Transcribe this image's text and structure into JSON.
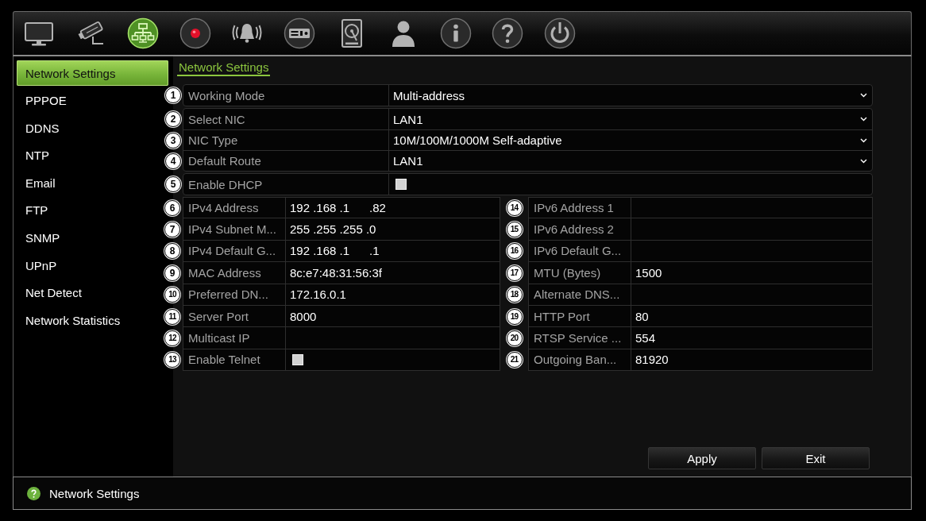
{
  "toolbar": [
    {
      "selected": false
    },
    {
      "selected": false
    },
    {
      "selected": true
    },
    {
      "selected": false
    },
    {
      "selected": false
    },
    {
      "selected": false
    },
    {
      "selected": false
    },
    {
      "selected": false
    },
    {
      "selected": false
    },
    {
      "selected": false
    },
    {
      "selected": false
    }
  ],
  "sidebar": {
    "items": [
      {
        "label": "Network Settings",
        "selected": true
      },
      {
        "label": "PPPOE",
        "selected": false
      },
      {
        "label": "DDNS",
        "selected": false
      },
      {
        "label": "NTP",
        "selected": false
      },
      {
        "label": "Email",
        "selected": false
      },
      {
        "label": "FTP",
        "selected": false
      },
      {
        "label": "SNMP",
        "selected": false
      },
      {
        "label": "UPnP",
        "selected": false
      },
      {
        "label": "Net Detect",
        "selected": false
      },
      {
        "label": "Network Statistics",
        "selected": false
      }
    ]
  },
  "tabs": [
    {
      "label": "Network Settings",
      "selected": true
    }
  ],
  "form": {
    "sections": [
      {
        "rows": [
          {
            "marker": "1",
            "label": "Working Mode",
            "kind": "dropdown",
            "value": "Multi-address"
          }
        ]
      },
      {
        "rows": [
          {
            "marker": "2",
            "label": "Select NIC",
            "kind": "dropdown",
            "value": "LAN1"
          },
          {
            "marker": "3",
            "label": "NIC Type",
            "kind": "dropdown",
            "value": "10M/100M/1000M Self-adaptive"
          },
          {
            "marker": "4",
            "label": "Default Route",
            "kind": "dropdown",
            "value": "LAN1"
          }
        ]
      },
      {
        "rows": [
          {
            "marker": "5",
            "label": "Enable DHCP",
            "kind": "checkbox",
            "checked": false
          }
        ]
      }
    ],
    "pairs": [
      {
        "left": {
          "marker": "6",
          "label": "IPv4 Address",
          "kind": "text",
          "value": "192 .168 .1      .82"
        },
        "right": {
          "marker": "14",
          "label": "IPv6 Address 1",
          "kind": "text"
        }
      },
      {
        "left": {
          "marker": "7",
          "label": "IPv4 Subnet M...",
          "kind": "text",
          "value": "255 .255 .255 .0"
        },
        "right": {
          "marker": "15",
          "label": "IPv6 Address 2",
          "kind": "text"
        }
      },
      {
        "left": {
          "marker": "8",
          "label": "IPv4 Default G...",
          "kind": "text",
          "value": "192 .168 .1      .1"
        },
        "right": {
          "marker": "16",
          "label": "IPv6 Default G...",
          "kind": "text"
        }
      },
      {
        "left": {
          "marker": "9",
          "label": "MAC Address",
          "kind": "text",
          "value": "8c:e7:48:31:56:3f"
        },
        "right": {
          "marker": "17",
          "label": "MTU (Bytes)",
          "kind": "text",
          "value": "1500"
        }
      },
      {
        "left": {
          "marker": "10",
          "label": "Preferred DN...",
          "kind": "text",
          "value": "172.16.0.1"
        },
        "right": {
          "marker": "18",
          "label": "Alternate DNS...",
          "kind": "text"
        }
      },
      {
        "left": {
          "marker": "11",
          "label": "Server Port",
          "kind": "text",
          "value": "8000"
        },
        "right": {
          "marker": "19",
          "label": "HTTP Port",
          "kind": "text",
          "value": "80"
        }
      },
      {
        "left": {
          "marker": "12",
          "label": "Multicast IP",
          "kind": "text"
        },
        "right": {
          "marker": "20",
          "label": "RTSP Service ...",
          "kind": "text",
          "value": "554"
        }
      },
      {
        "left": {
          "marker": "13",
          "label": "Enable Telnet",
          "kind": "checkbox",
          "checked": false
        },
        "right": {
          "marker": "21",
          "label": "Outgoing Ban...",
          "kind": "text",
          "value": "81920"
        }
      }
    ]
  },
  "buttons": [
    {
      "label": "Apply"
    },
    {
      "label": "Exit"
    }
  ],
  "status_bar": {
    "text": "Network Settings"
  }
}
